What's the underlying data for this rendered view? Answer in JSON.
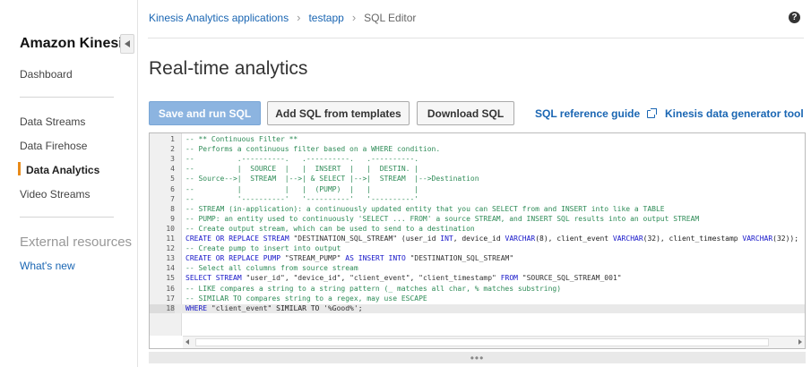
{
  "sidebar": {
    "brand": "Amazon Kinesis",
    "dashboard": "Dashboard",
    "items": [
      {
        "label": "Data Streams"
      },
      {
        "label": "Data Firehose"
      },
      {
        "label": "Data Analytics"
      },
      {
        "label": "Video Streams"
      }
    ],
    "active_item": "Data Analytics",
    "external_title": "External resources",
    "whats_new": "What's new"
  },
  "breadcrumb": {
    "items": [
      "Kinesis Analytics applications",
      "testapp"
    ],
    "current": "SQL Editor",
    "separator": "›"
  },
  "help_glyph": "?",
  "page_title": "Real-time analytics",
  "toolbar": {
    "save_run": "Save and run SQL",
    "add_templates": "Add SQL from templates",
    "download": "Download SQL",
    "sql_reference": "SQL reference guide",
    "data_generator": "Kinesis data generator tool"
  },
  "editor": {
    "active_line": 18,
    "lines": [
      "-- ** Continuous Filter **",
      "-- Performs a continuous filter based on a WHERE condition.",
      "--          .----------.   .----------.   .----------.",
      "--          |  SOURCE  |   |  INSERT  |   |  DESTIN. |",
      "-- Source-->|  STREAM  |-->| & SELECT |-->|  STREAM  |-->Destination",
      "--          |          |   |  (PUMP)  |   |          |",
      "--          '----------'   '----------'   '----------'",
      "-- STREAM (in-application): a continuously updated entity that you can SELECT from and INSERT into like a TABLE",
      "-- PUMP: an entity used to continuously 'SELECT ... FROM' a source STREAM, and INSERT SQL results into an output STREAM",
      "-- Create output stream, which can be used to send to a destination",
      "CREATE OR REPLACE STREAM \"DESTINATION_SQL_STREAM\" (user_id INT, device_id VARCHAR(8), client_event VARCHAR(32), client_timestamp VARCHAR(32));",
      "-- Create pump to insert into output",
      "CREATE OR REPLACE PUMP \"STREAM_PUMP\" AS INSERT INTO \"DESTINATION_SQL_STREAM\"",
      "-- Select all columns from source stream",
      "SELECT STREAM \"user_id\", \"device_id\", \"client_event\", \"client_timestamp\" FROM \"SOURCE_SQL_STREAM_001\"",
      "-- LIKE compares a string to a string pattern (_ matches all char, % matches substring)",
      "-- SIMILAR TO compares string to a regex, may use ESCAPE",
      "WHERE \"client_event\" SIMILAR TO '%Good%';"
    ]
  },
  "resize_handle": "•••"
}
